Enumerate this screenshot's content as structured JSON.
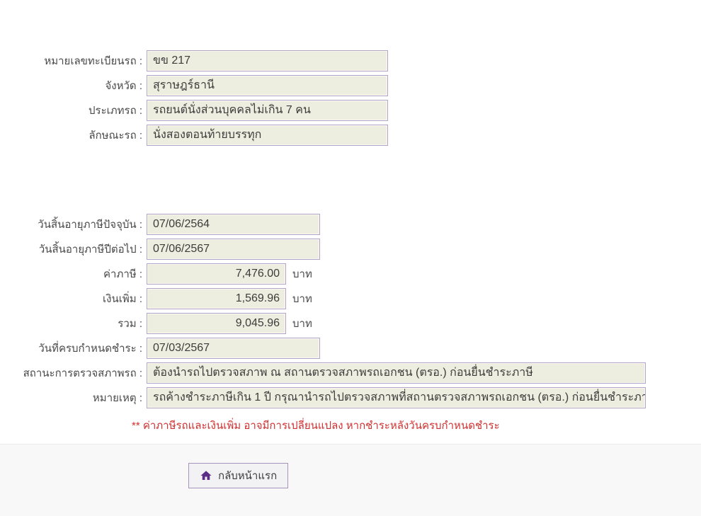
{
  "vehicle_info": {
    "rows": [
      {
        "label": "หมายเลขทะเบียนรถ :",
        "value": "ขข 217"
      },
      {
        "label": "จังหวัด :",
        "value": "สุราษฎร์ธานี"
      },
      {
        "label": "ประเภทรถ :",
        "value": "รถยนต์นั่งส่วนบุคคลไม่เกิน 7 คน"
      },
      {
        "label": "ลักษณะรถ :",
        "value": "นั่งสองตอนท้ายบรรทุก"
      }
    ]
  },
  "tax_info": {
    "rows": [
      {
        "label": "วันสิ้นอายุภาษีปัจจุบัน :",
        "value": "07/06/2564"
      },
      {
        "label": "วันสิ้นอายุภาษีปีต่อไป :",
        "value": "07/06/2567"
      },
      {
        "label": "ค่าภาษี :",
        "value": "7,476.00",
        "unit": "บาท"
      },
      {
        "label": "เงินเพิ่ม :",
        "value": "1,569.96",
        "unit": "บาท"
      },
      {
        "label": "รวม :",
        "value": "9,045.96",
        "unit": "บาท"
      },
      {
        "label": "วันที่ครบกำหนดชำระ :",
        "value": "07/03/2567"
      },
      {
        "label": "สถานะการตรวจสภาพรถ :",
        "value": "ต้องนำรถไปตรวจสภาพ ณ สถานตรวจสภาพรถเอกชน (ตรอ.) ก่อนยื่นชำระภาษี"
      },
      {
        "label": "หมายเหตุ :",
        "value": "รถค้างชำระภาษีเกิน 1 ปี กรุณานำรถไปตรวจสภาพที่สถานตรวจสภาพรถเอกชน (ตรอ.) ก่อนยื่นชำระภาษี"
      }
    ]
  },
  "note": {
    "text": "** ค่าภาษีรถและเงินเพิ่ม อาจมีการเปลี่ยนแปลง หากชำระหลังวันครบกำหนดชำระ"
  },
  "footer": {
    "home_button_label": "กลับหน้าแรก",
    "home_icon": "home-icon"
  },
  "colors": {
    "field_background": "#eeeee0",
    "field_border": "#b2a4c6",
    "note_red": "#d03030",
    "button_border": "#a794bd",
    "button_background": "#f2f1f4",
    "home_icon_purple": "#5c2d87",
    "footer_background": "#f8f8f8"
  }
}
